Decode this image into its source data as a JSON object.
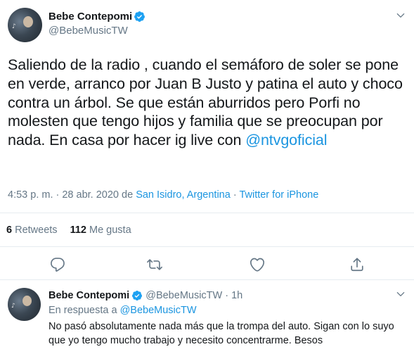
{
  "main_tweet": {
    "display_name": "Bebe Contepomi",
    "handle": "@BebeMusicTW",
    "text_before_mention": "Saliendo de la radio , cuando el semáforo de soler se pone en verde, arranco por Juan B Justo y patina el auto y choco contra un árbol. Se que están aburridos pero Porfi no molesten que tengo hijos y familia que se preocupan por nada. En casa por hacer ig live con ",
    "mention": "@ntvgoficial",
    "time_date": "4:53 p. m. · 28 abr. 2020 de ",
    "location": "San Isidro, Argentina",
    "separator": " · ",
    "source": "Twitter for iPhone",
    "retweets_count": "6",
    "retweets_label": "Retweets",
    "likes_count": "112",
    "likes_label": "Me gusta"
  },
  "reply_tweet": {
    "display_name": "Bebe Contepomi",
    "handle_time": " @BebeMusicTW · 1h",
    "reply_prefix": "En respuesta a ",
    "reply_to_handle": "@BebeMusicTW",
    "text": "No pasó absolutamente nada más que la trompa del auto. Sigan con lo suyo que yo tengo mucho trabajo y necesito concentrarme. Besos"
  },
  "icons": [
    "verified-badge-icon",
    "chevron-down-icon",
    "reply-icon",
    "retweet-icon",
    "like-icon",
    "share-icon"
  ],
  "colors": {
    "link": "#1b95e0",
    "verified": "#1da1f2",
    "secondary_text": "#657786",
    "divider": "#e6ecf0"
  }
}
